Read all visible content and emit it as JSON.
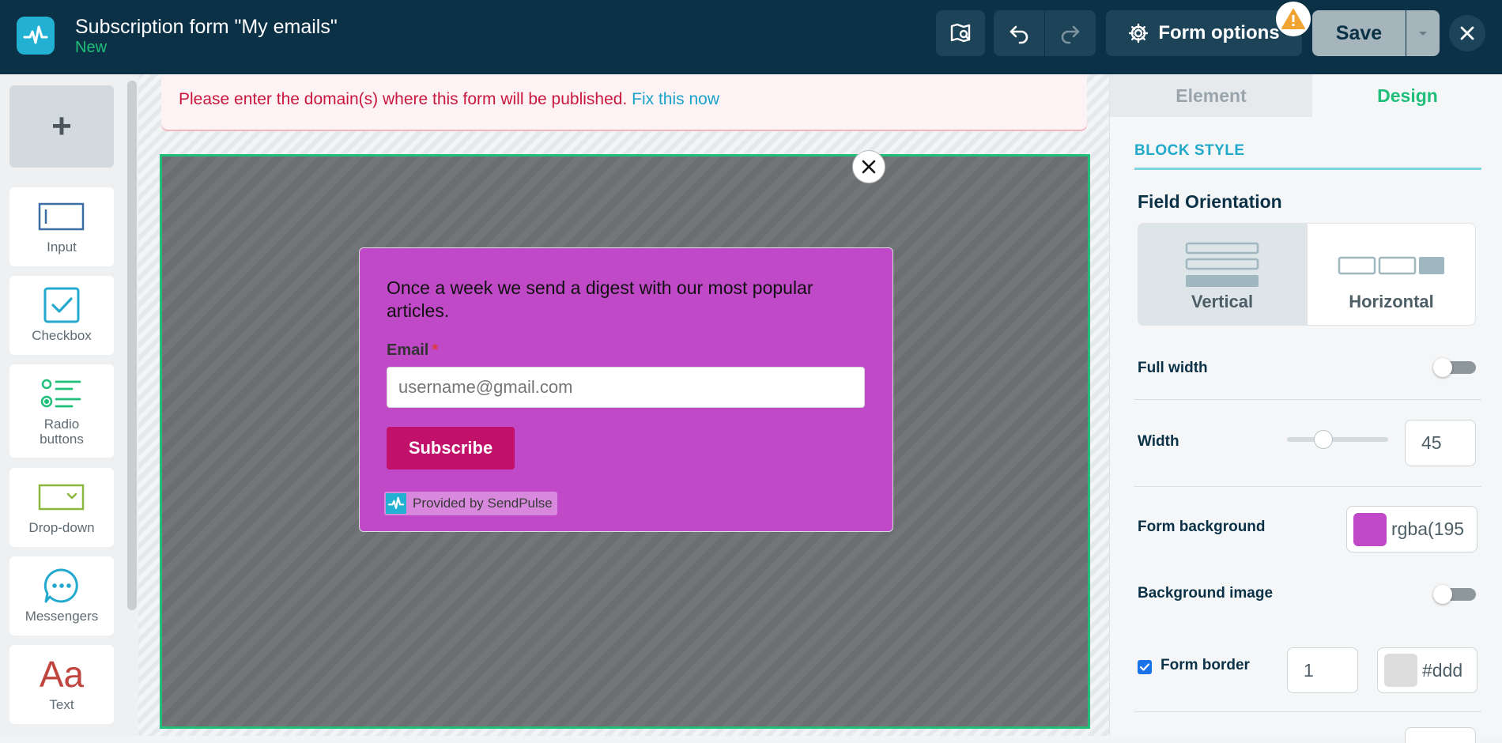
{
  "header": {
    "title": "Subscription form \"My emails\"",
    "status": "New",
    "form_options_label": "Form options",
    "save_label": "Save"
  },
  "sidebar": {
    "add_label": "+",
    "tools": [
      {
        "label": "Input",
        "icon": "input-icon"
      },
      {
        "label": "Checkbox",
        "icon": "checkbox-icon"
      },
      {
        "label": "Radio buttons",
        "icon": "radio-buttons-icon"
      },
      {
        "label": "Drop-down",
        "icon": "dropdown-icon"
      },
      {
        "label": "Messengers",
        "icon": "messengers-icon"
      },
      {
        "label": "Text",
        "icon": "text-icon",
        "glyph": "Aa"
      }
    ]
  },
  "alert": {
    "message": "Please enter the domain(s) where this form will be published.",
    "link": "Fix this now"
  },
  "form": {
    "description": "Once a week we send a digest with our most popular articles.",
    "email_label": "Email",
    "required_mark": "*",
    "email_placeholder": "username@gmail.com",
    "subscribe_label": "Subscribe",
    "branding": "Provided by SendPulse",
    "background_color": "#c049c8"
  },
  "panel": {
    "tabs": [
      "Element",
      "Design"
    ],
    "active_tab": "Design",
    "section": "BLOCK STYLE",
    "field_orientation": {
      "title": "Field Orientation",
      "options": [
        "Vertical",
        "Horizontal"
      ],
      "selected": "Vertical"
    },
    "full_width": {
      "label": "Full width",
      "on": false
    },
    "width": {
      "label": "Width",
      "value": "45"
    },
    "form_background": {
      "label": "Form background",
      "value": "rgba(195",
      "color": "#c049c8"
    },
    "background_image": {
      "label": "Background image",
      "on": false
    },
    "form_border": {
      "label": "Form border",
      "checked": true,
      "size": "1",
      "color_value": "#ddd",
      "color": "#dddddd"
    }
  },
  "colors": {
    "topbar": "#0b3147",
    "accent_green": "#1fbf7a",
    "accent_blue": "#20a9c9",
    "error_red": "#c8183e",
    "subscribe_button": "#c1116a"
  }
}
